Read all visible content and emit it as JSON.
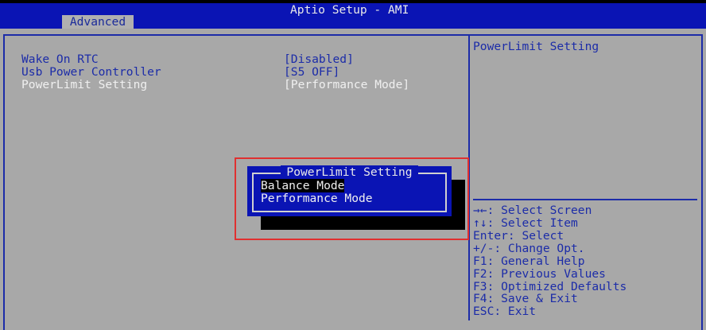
{
  "header": {
    "title": "Aptio Setup - AMI",
    "active_tab": "Advanced"
  },
  "settings": [
    {
      "label": "Wake On RTC",
      "value": "[Disabled]"
    },
    {
      "label": "Usb Power Controller",
      "value": "[S5 OFF]"
    },
    {
      "label": "PowerLimit Setting",
      "value": "[Performance Mode]"
    }
  ],
  "help_text": "PowerLimit Setting",
  "popup": {
    "title": "PowerLimit Setting",
    "options": [
      "Balance Mode",
      "Performance Mode"
    ],
    "selected": "Balance Mode"
  },
  "keys": [
    "→←: Select Screen",
    "↑↓: Select Item",
    "Enter: Select",
    "+/-: Change Opt.",
    "F1: General Help",
    "F2: Previous Values",
    "F3: Optimized Defaults",
    "F4: Save & Exit",
    "ESC: Exit"
  ],
  "colors": {
    "header": "#0a14b4",
    "background": "#a8a8a8",
    "text": "#1c2ca8",
    "highlight_box": "#e03030"
  }
}
